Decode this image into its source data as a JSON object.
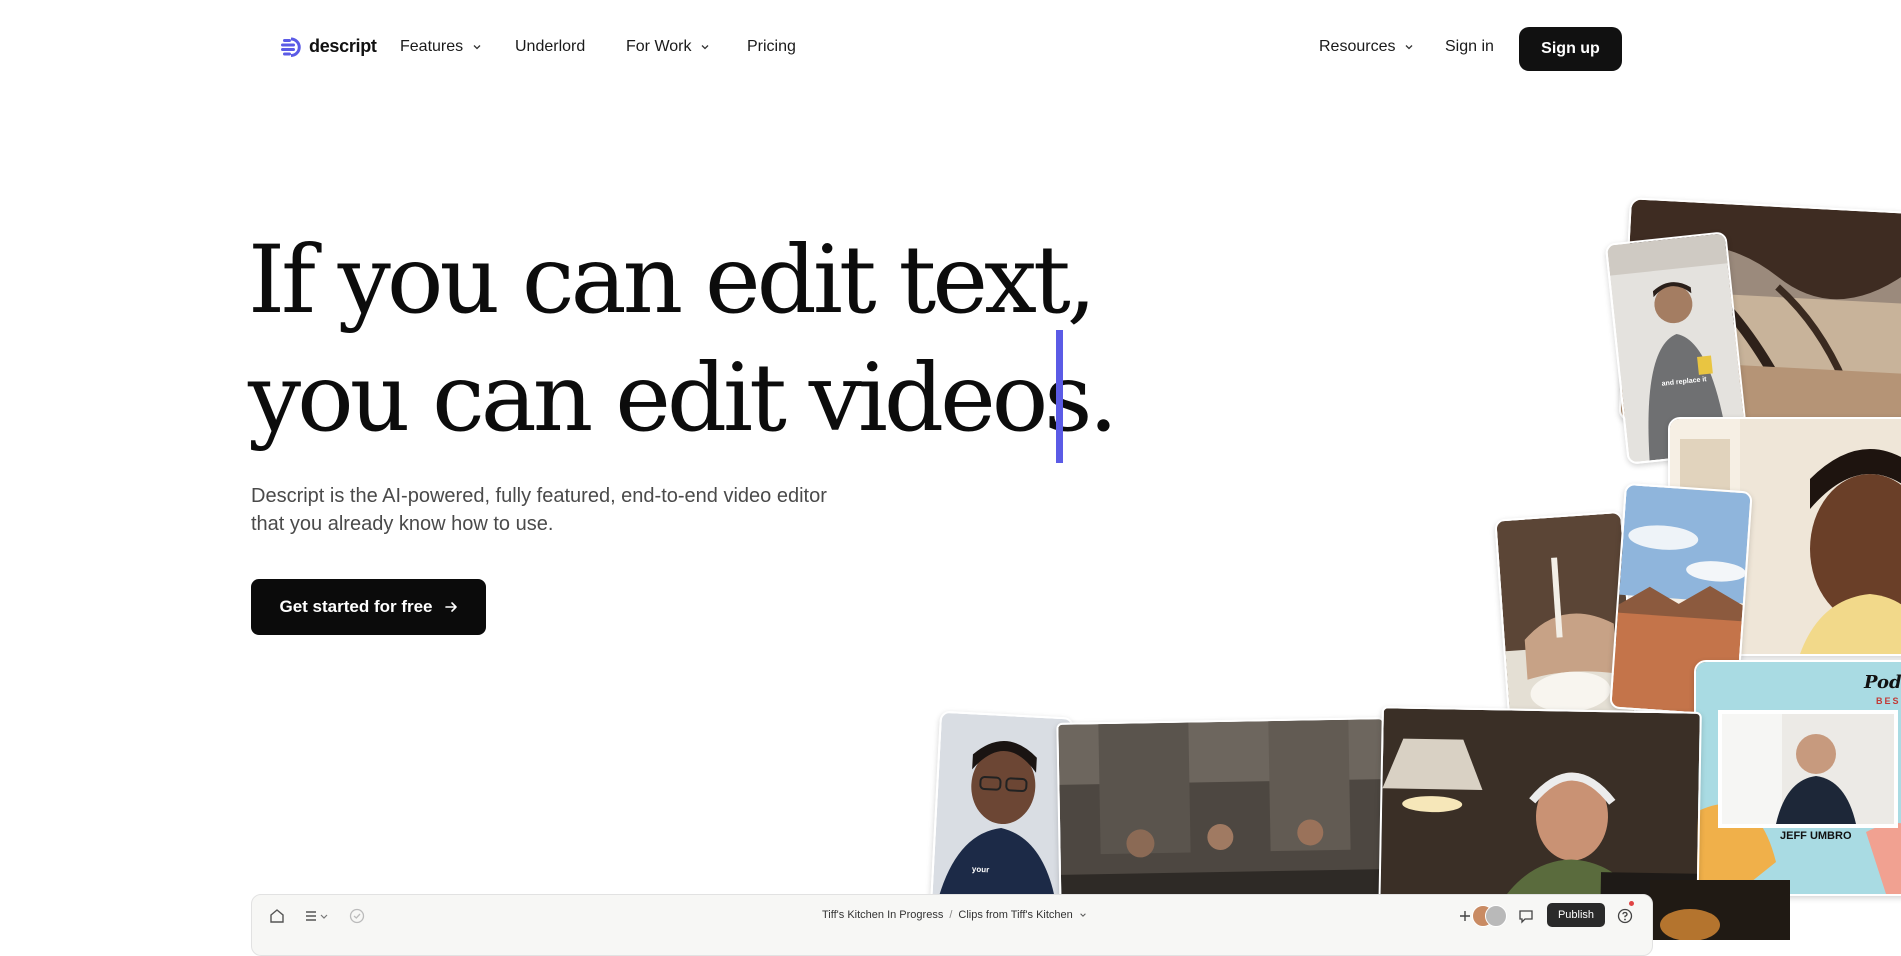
{
  "brand": {
    "name": "descript",
    "color": "#5b5be6"
  },
  "nav": {
    "items": [
      {
        "label": "Features",
        "has_dropdown": true
      },
      {
        "label": "Underlord",
        "has_dropdown": false
      },
      {
        "label": "For Work",
        "has_dropdown": true
      },
      {
        "label": "Pricing",
        "has_dropdown": false
      }
    ],
    "resources": {
      "label": "Resources",
      "has_dropdown": true
    },
    "sign_in": "Sign in",
    "sign_up": "Sign up"
  },
  "hero": {
    "headline_line1": "If you can edit text,",
    "headline_line2": "you can edit videos.",
    "subcopy_line1": "Descript is the AI-powered, fully featured, end-to-end video editor",
    "subcopy_line2": "that you already know how to use.",
    "cta_label": "Get started for free",
    "caret_color": "#5b5be6"
  },
  "collage": {
    "tile_captions": {
      "man_shirt_text": "and replace it",
      "podcast_name_tag": "JEFF UMBRO",
      "podcast_logo": "Pod",
      "podcast_logo_sub": "BES",
      "hoodie_text": "your"
    }
  },
  "editor": {
    "crumb_project": "Tiff's Kitchen In Progress",
    "crumb_separator": "/",
    "crumb_composition": "Clips from Tiff's Kitchen",
    "publish_label": "Publish",
    "icons": [
      "home-icon",
      "menu-icon",
      "check-circle-icon",
      "plus-icon",
      "comment-icon",
      "help-icon"
    ]
  }
}
